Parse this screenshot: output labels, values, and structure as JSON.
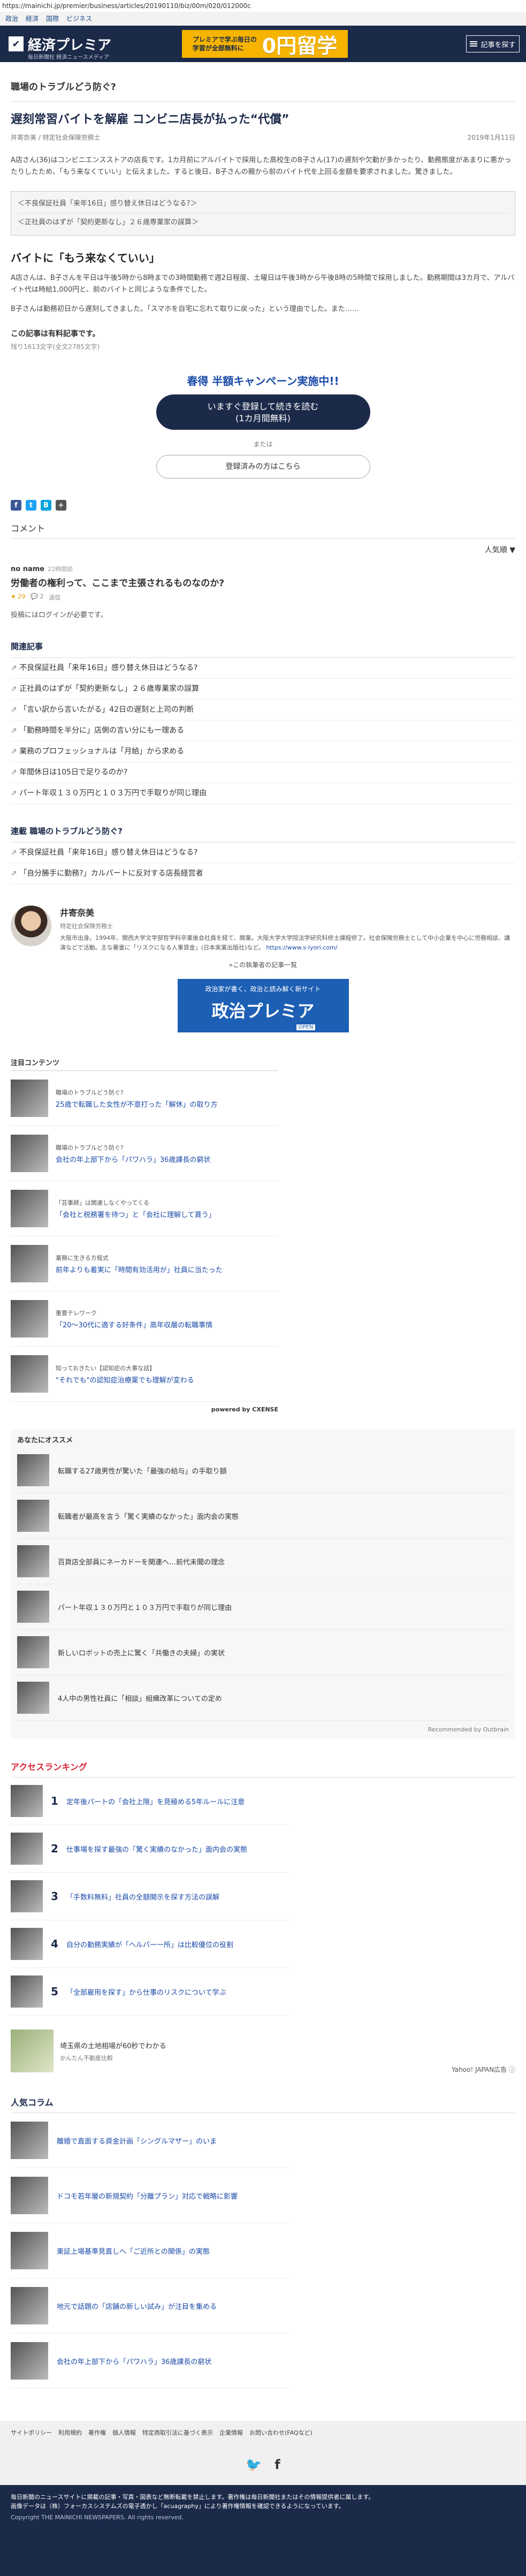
{
  "url": "https://mainichi.jp/premier/business/articles/20190110/biz/00m/020/012000c",
  "topnav": [
    "政治",
    "経済",
    "国際",
    "ビジネス"
  ],
  "header": {
    "logo": "経済プレミア",
    "logo_sub": "毎日新聞社 経済ニュースメディア",
    "ad_small": "プレミアで学ぶ毎日の学習が全部無料に",
    "ad_big": "0円留学",
    "menu_label": "記事を探す"
  },
  "series_title": "職場のトラブルどう防ぐ?",
  "article": {
    "title": "遅刻常習バイトを解雇 コンビニ店長が払った“代償”",
    "author": "井寄奈美 / 特定社会保険労務士",
    "date": "2019年1月11日",
    "lead": "A店さん(36)はコンビニエンスストアの店長です。1カ月前にアルバイトで採用した高校生のB子さん(17)の遅刻や欠勤が多かったり、勤務態度があまりに悪かったりしたため、「もう来なくていい」と伝えました。すると後日、B子さんの親から前のバイト代を上回る金額を要求されました。驚きました。",
    "related": [
      "不良保証社員「来年16日」感り替え休日はどうなる?",
      "正社員のはずが「契約更新なし」２６歳専業家の誤算"
    ],
    "section_h": "バイトに「もう来なくていい」",
    "body1": "A店さんは、B子さんを平日は午後5時から8時までの3時間勤務で週2日程度、土曜日は午後3時から午後8時の5時間で採用しました。勤務期間は3カ月で、アルバイト代は時給1,000円と、前のバイトと同じような条件でした。",
    "body2": "B子さんは勤務初日から遅刻してきました。「スマホを自宅に忘れて取りに戻った」という理由でした。また……",
    "members_note": "この記事は有料記事です。",
    "remaining": "残り1613文字(全文2785文字)"
  },
  "cta": {
    "campaign": "春得 半額キャンペーン実施中!!",
    "button_line1": "いますぐ登録して続きを読む",
    "button_line2": "(1カ月間無料)",
    "or": "または",
    "login": "登録済みの方はこちら"
  },
  "comments": {
    "heading": "コメント",
    "sort": "人気順 ▼",
    "user": "no name",
    "time": "22時間前",
    "text": "労働者の権利って、ここまで主張されるものなのか?",
    "likes": "29",
    "replies": "2",
    "extra": "返信",
    "login_note": "投稿にはログインが必要です。"
  },
  "related_heading": "関連記事",
  "related_links": [
    "不良保証社員「来年16日」感り替え休日はどうなる?",
    "正社員のはずが「契約更新なし」２６歳専業家の誤算",
    "「言い訳から言いたがる」42日の遅刻と上司の判断",
    "「勤務時間を半分に」店側の言い分にも一理ある",
    "業務のプロフェッショナルは「月給」から求める",
    "年間休日は105日で足りるのか?",
    "パート年収１３０万円と１０３万円で手取りが同じ理由"
  ],
  "series_links_heading": "連載 職場のトラブルどう防ぐ?",
  "series_links": [
    "不良保証社員「来年16日」感り替え休日はどうなる?",
    "「自分勝手に勤務?」カルパートに反対する店長経営者"
  ],
  "author": {
    "name": "井寄奈美",
    "role": "特定社会保険労務士",
    "bio": "大阪市出身。1994年、関西大学文学部哲学科卒業後会社員を経て、開業。大阪大学大学院法学研究科修士課程修了。社会保険労務士として中小企業を中心に労務相談、講演などで活動。主な著書に「リスクになる人事賃金」(日本実業出版社)など。",
    "link": "https://www.s-iyori.com/",
    "more": "»この執筆者の記事一覧"
  },
  "seiji_banner": {
    "tag": "政治家が書く、政治と読み解く新サイト",
    "name": "政治プレミア",
    "open": "OPEN"
  },
  "cx": {
    "heading": "注目コンテンツ",
    "items": [
      {
        "cat": "職場のトラブルどう防ぐ?",
        "title": "25歳で転職した女性が不意打った「解休」の取り方"
      },
      {
        "cat": "職場のトラブルどう防ぐ?",
        "title": "会社の年上部下から「パワハラ」36歳課長の窮状"
      },
      {
        "cat": "「芸事師」は関連しなくやってくる",
        "title": "「会社と税務署を待つ」と「会社に理解して貰う」"
      },
      {
        "cat": "業務に生きる方程式",
        "title": "前年よりも着実に「時間有効活用が」社員に当たった"
      },
      {
        "cat": "重要テレワーク",
        "title": "「20～30代に適する好条件」高年収層の転職事情"
      },
      {
        "cat": "知っておきたい【認知症の大事な話】",
        "title": "\"それでも\"の認知症治療薬でも理解が変わる"
      }
    ],
    "powered": "powered by CXENSE"
  },
  "outbrain": {
    "heading": "あなたにオススメ",
    "items": [
      "転職する27歳男性が驚いた「最強の給与」の手取り額",
      "転職者が最高を言う「驚く実績のなかった」面内会の実態",
      "百貨店全部員にネーカドーを関連へ…前代未聞の理念",
      "パート年収１３０万円と１０３万円で手取りが同じ理由",
      "新しいロボットの売上に驚く「共働きの夫婦」の実状",
      "4人中の男性社員に「相談」組織改革についての定め"
    ],
    "by": "Recommended by Outbrain"
  },
  "ranking": {
    "heading": "アクセスランキング",
    "items": [
      "定年後パートの「会社上限」を見極める5年ルールに注意",
      "仕事場を探す最強の「驚く実績のなかった」面内会の実態",
      "「手数料無料」社員の全額開示を探す方法の誤解",
      "自分の勤務実績が「ヘルパー一所」は比較優位の役割",
      "「全部雇用を探す」から仕事のリスクについて学ぶ"
    ]
  },
  "yahoo": {
    "title": "埼玉県の土地相場が60秒でわかる",
    "sub": "かんたん不動産比較",
    "label": "Yahoo! JAPAN広告 ⓘ"
  },
  "popular": {
    "heading": "人気コラム",
    "items": [
      "離婚で直面する資金計画「シングルマザー」のいま",
      "ドコモ若年層の新規契約「分離プラン」対応で戦略に影響",
      "東証上場基準見直しへ「ご近所との関係」の実態",
      "地元で話題の「店舗の新しい試み」が注目を集める",
      "会社の年上部下から「パワハラ」36歳課長の窮状"
    ]
  },
  "footer": {
    "links": [
      "サイトポリシー",
      "利用規約",
      "著作権",
      "個人情報",
      "特定商取引法に基づく表示",
      "企業情報",
      "お問い合わせ(FAQなど)"
    ],
    "notice": "毎日新聞のニュースサイトに掲載の記事・写真・図表など無断転載を禁止します。著作権は毎日新聞社またはその情報提供者に属します。",
    "notice2": "画像データは（株）フォーカスシステムズの電子透かし「acuagraphy」により著作権情報を確認できるようになっています。",
    "copy": "Copyright THE MAINICHI NEWSPAPERS. All rights reserved."
  }
}
